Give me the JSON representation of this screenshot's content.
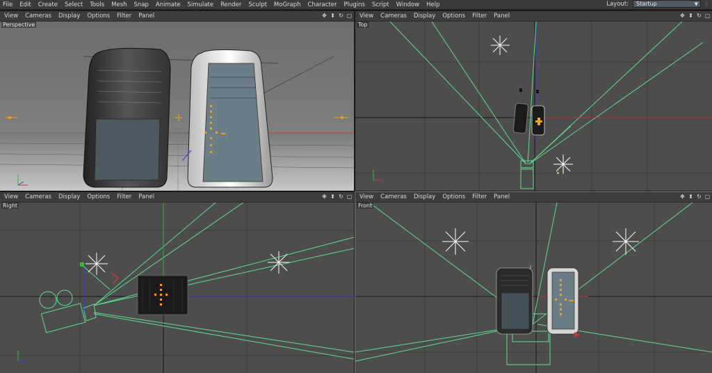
{
  "menubar": {
    "items": [
      "File",
      "Edit",
      "Create",
      "Select",
      "Tools",
      "Mesh",
      "Snap",
      "Animate",
      "Simulate",
      "Render",
      "Sculpt",
      "MoGraph",
      "Character",
      "Plugins",
      "Script",
      "Window",
      "Help"
    ],
    "layout_label": "Layout:",
    "layout_value": "Startup"
  },
  "viewport_menu": [
    "View",
    "Cameras",
    "Display",
    "Options",
    "Filter",
    "Panel"
  ],
  "viewports": {
    "perspective": {
      "label": "Perspective"
    },
    "top": {
      "label": "Top"
    },
    "right": {
      "label": "Right"
    },
    "front": {
      "label": "Front"
    }
  },
  "icons": {
    "nav": [
      "move-view-icon",
      "zoom-view-icon",
      "rotate-view-icon",
      "toggle-layout-icon"
    ],
    "layout_dropdown": "chevron-down-icon",
    "menubar_corner": "grip-icon"
  },
  "colors": {
    "grid_bg": "#4d4d4d",
    "grid_line": "#3f3f3f",
    "camera_green": "#5ee08a",
    "axis_red": "#c43a3a",
    "axis_blue": "#3a3ad8",
    "axis_green": "#2fbf2f",
    "handle_orange": "#f3a416",
    "layout_select": "#4e5868"
  }
}
